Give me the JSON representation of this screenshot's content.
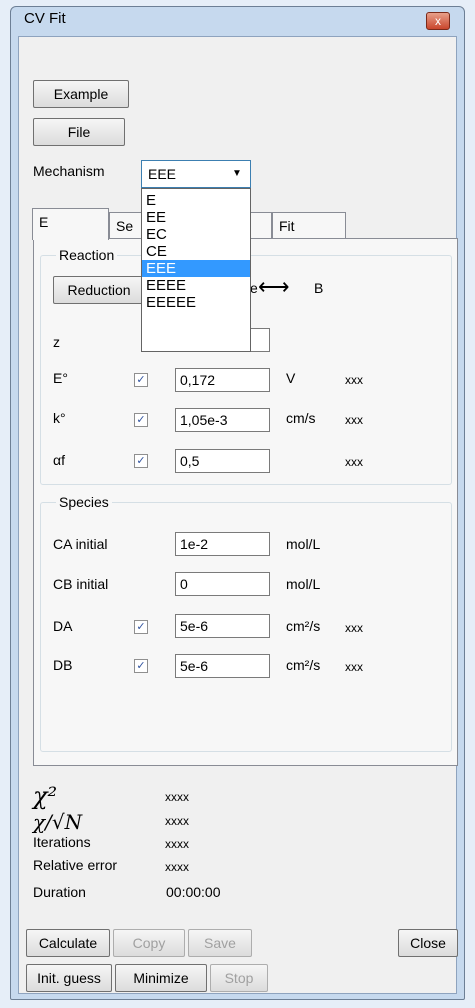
{
  "window": {
    "title": "CV Fit",
    "close_glyph": "x"
  },
  "buttons": {
    "example": "Example",
    "file": "File"
  },
  "mechanism": {
    "label": "Mechanism",
    "selected": "EEE",
    "options": [
      "E",
      "EE",
      "EC",
      "CE",
      "EEE",
      "EEEE",
      "EEEEE"
    ]
  },
  "tabs": [
    "E",
    "Se",
    "n",
    "Fit"
  ],
  "reaction": {
    "title": "Reaction",
    "button": "Reduction",
    "equation_tail": "e",
    "arrow": "⟷",
    "product": "B",
    "rows": [
      {
        "label": "z",
        "value": "",
        "unit": "",
        "extra": ""
      },
      {
        "label": "E°",
        "value": "0,172",
        "unit": "V",
        "extra": "xxx",
        "checked": true
      },
      {
        "label": "k°",
        "value": "1,05e-3",
        "unit": "cm/s",
        "extra": "xxx",
        "checked": true
      },
      {
        "label": "αf",
        "value": "0,5",
        "unit": "",
        "extra": "xxx",
        "checked": true
      }
    ]
  },
  "species": {
    "title": "Species",
    "rows": [
      {
        "label": "CA initial",
        "value": "1e-2",
        "unit": "mol/L",
        "extra": ""
      },
      {
        "label": "CB initial",
        "value": "0",
        "unit": "mol/L",
        "extra": ""
      },
      {
        "label": "DA",
        "value": "5e-6",
        "unit": "cm²/s",
        "extra": "xxx",
        "checked": true
      },
      {
        "label": "DB",
        "value": "5e-6",
        "unit": "cm²/s",
        "extra": "xxx",
        "checked": true
      }
    ]
  },
  "stats": [
    {
      "label": "χ²",
      "value": "xxxx"
    },
    {
      "label": "χ/√N",
      "value": "xxxx"
    },
    {
      "label": "Iterations",
      "value": "xxxx"
    },
    {
      "label": "Relative error",
      "value": "xxxx"
    },
    {
      "label": "Duration",
      "value": "00:00:00"
    }
  ],
  "bottom_buttons": {
    "calculate": "Calculate",
    "copy": "Copy",
    "save": "Save",
    "close": "Close",
    "init_guess": "Init. guess",
    "minimize": "Minimize",
    "stop": "Stop"
  },
  "checkmark": "✓"
}
